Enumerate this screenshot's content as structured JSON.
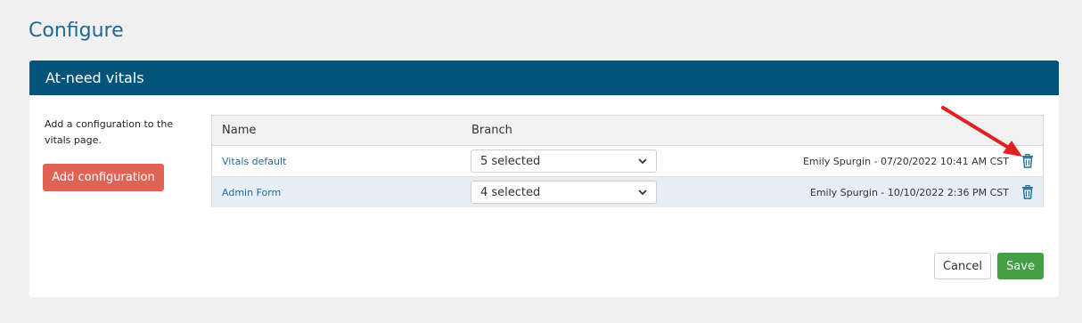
{
  "page": {
    "title": "Configure"
  },
  "panel": {
    "title": "At-need vitals",
    "intro": "Add a configuration to the vitals page.",
    "add_button": "Add configuration"
  },
  "table": {
    "headers": {
      "name": "Name",
      "branch": "Branch"
    },
    "rows": [
      {
        "name": "Vitals default",
        "branch": "5 selected",
        "meta": "Emily Spurgin - 07/20/2022 10:41 AM CST"
      },
      {
        "name": "Admin Form",
        "branch": "4 selected",
        "meta": "Emily Spurgin - 10/10/2022 2:36 PM CST"
      }
    ]
  },
  "footer": {
    "cancel_label": "Cancel",
    "save_label": "Save"
  },
  "icons": {
    "delete": "trash-icon",
    "dropdown": "chevron-down-icon",
    "annotation": "red-arrow"
  },
  "colors": {
    "header_bg": "#03547a",
    "title": "#1f6795",
    "add_button": "#e06355",
    "save_button": "#43a047",
    "link": "#1f6ba0",
    "alt_row": "#e7eef6",
    "annotation_arrow": "#e02020"
  }
}
